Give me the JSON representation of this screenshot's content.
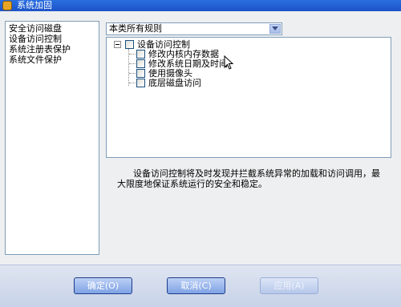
{
  "window": {
    "title": "系统加固"
  },
  "sidebar": {
    "items": [
      {
        "label": "安全访问磁盘"
      },
      {
        "label": "设备访问控制"
      },
      {
        "label": "系统注册表保护"
      },
      {
        "label": "系统文件保护"
      }
    ],
    "selected_index": 1
  },
  "filter": {
    "value": "本类所有规则"
  },
  "tree": {
    "root": {
      "label": "设备访问控制",
      "checked": false,
      "expanded": true
    },
    "children": [
      {
        "label": "修改内核内存数据",
        "checked": false
      },
      {
        "label": "修改系统日期及时间",
        "checked": false
      },
      {
        "label": "使用摄像头",
        "checked": false
      },
      {
        "label": "底层磁盘访问",
        "checked": false
      }
    ]
  },
  "description": "设备访问控制将及时发现并拦截系统异常的加载和访问调用，最大限度地保证系统运行的安全和稳定。",
  "buttons": {
    "ok": "确定(O)",
    "cancel": "取消(C)",
    "apply": "应用(A)"
  },
  "colors": {
    "title_bar": "#1c53c9",
    "button_blue": "#7fa2e4",
    "border": "#7f9db9"
  },
  "icons": {
    "title": "shield-icon",
    "dropdown": "chevron-down-icon",
    "cursor": "mouse-pointer-icon"
  }
}
